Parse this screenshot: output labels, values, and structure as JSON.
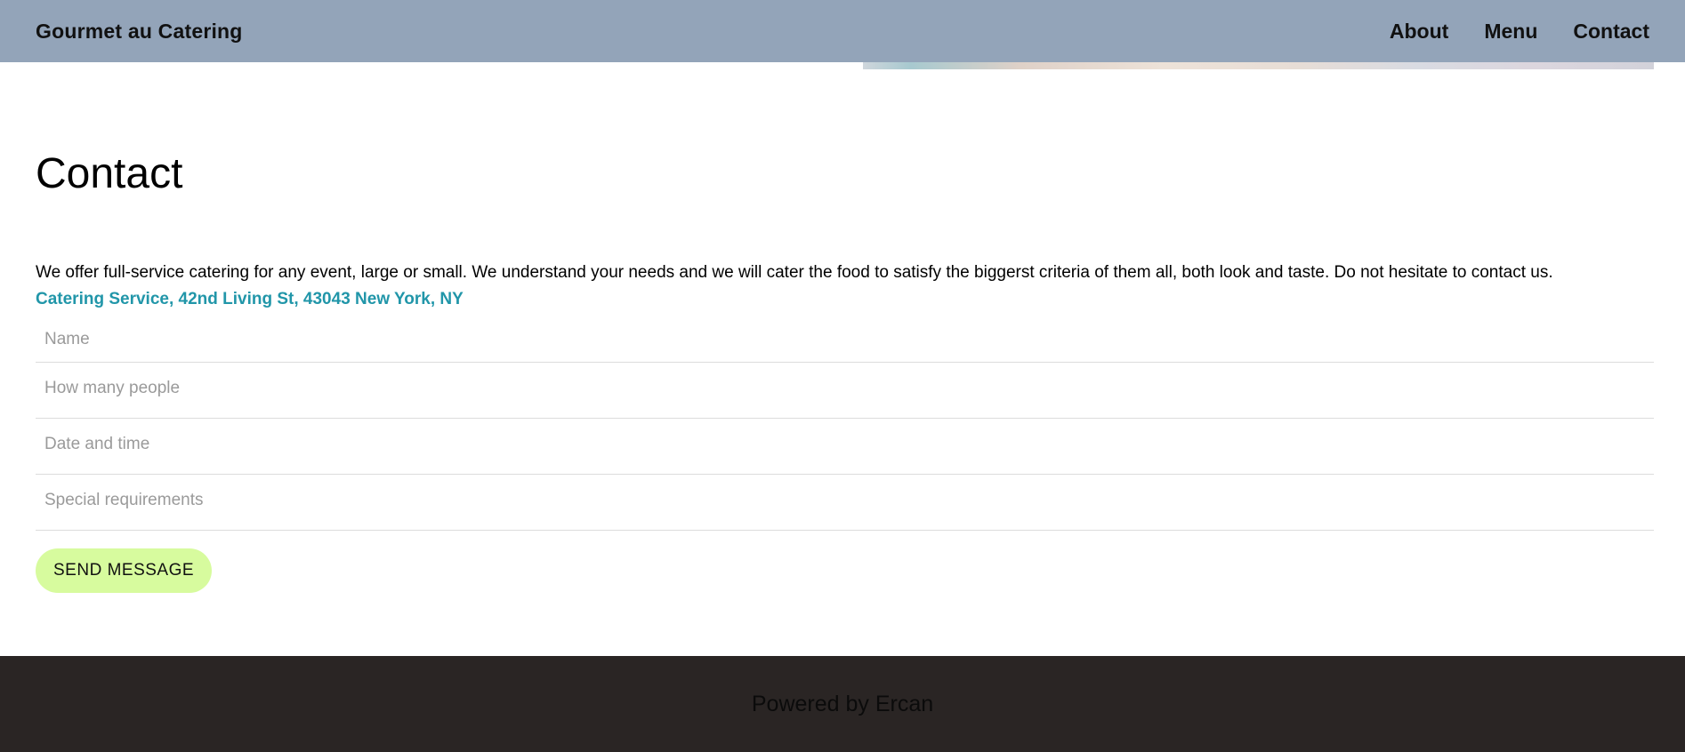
{
  "header": {
    "brand": "Gourmet au Catering",
    "nav": [
      {
        "label": "About"
      },
      {
        "label": "Menu"
      },
      {
        "label": "Contact"
      }
    ]
  },
  "contact": {
    "title": "Contact",
    "intro": "We offer full-service catering for any event, large or small. We understand your needs and we will cater the food to satisfy the biggerst criteria of them all, both look and taste. Do not hesitate to contact us.",
    "address": "Catering Service, 42nd Living St, 43043 New York, NY",
    "fields": {
      "name_placeholder": "Name",
      "people_placeholder": "How many people",
      "datetime_placeholder": "Date and time",
      "requirements_placeholder": "Special requirements",
      "name_value": "",
      "people_value": "",
      "datetime_value": "",
      "requirements_value": ""
    },
    "send_label": "SEND MESSAGE"
  },
  "footer": {
    "text": "Powered by Ercan"
  },
  "colors": {
    "header_bg": "#93a4b9",
    "address_link": "#2196a9",
    "send_button_bg": "#d7fb9e",
    "footer_bg": "#2a2524"
  }
}
